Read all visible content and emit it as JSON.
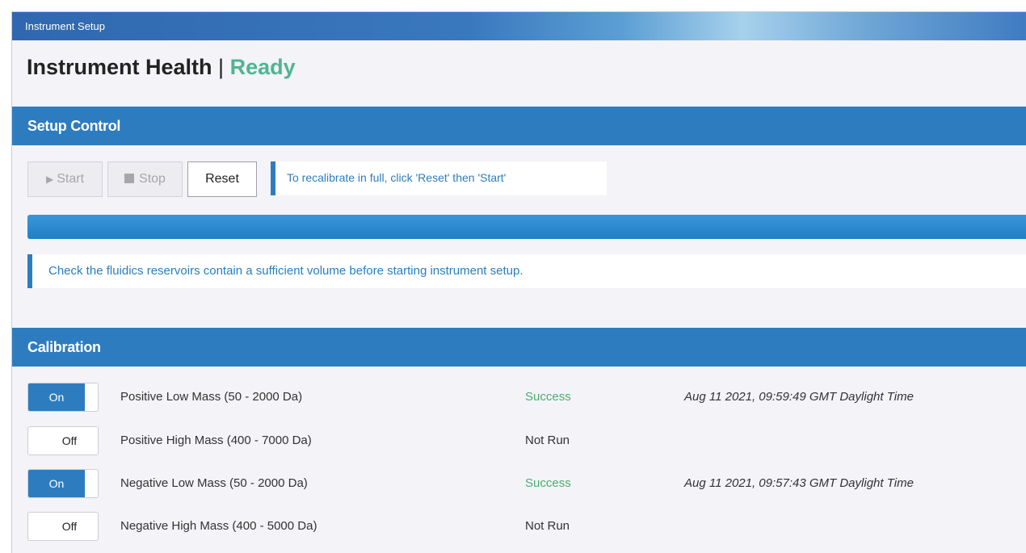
{
  "window": {
    "title": "Instrument Setup"
  },
  "health": {
    "title": "Instrument Health",
    "separator": "|",
    "status": "Ready"
  },
  "setup_control": {
    "header": "Setup Control",
    "buttons": {
      "start": "Start",
      "stop": "Stop",
      "reset": "Reset"
    },
    "hint": "To recalibrate in full, click 'Reset' then 'Start'",
    "progress": 1.0,
    "warning": "Check the fluidics reservoirs contain a sufficient volume before starting instrument setup."
  },
  "calibration": {
    "header": "Calibration",
    "rows": [
      {
        "toggle": "On",
        "name": "Positive Low Mass (50 - 2000 Da)",
        "status": "Success",
        "time": "Aug 11 2021, 09:59:49 GMT Daylight Time"
      },
      {
        "toggle": "Off",
        "name": "Positive High Mass (400 - 7000 Da)",
        "status": "Not Run",
        "time": ""
      },
      {
        "toggle": "On",
        "name": "Negative Low Mass (50 - 2000 Da)",
        "status": "Success",
        "time": "Aug 11 2021, 09:57:43 GMT Daylight Time"
      },
      {
        "toggle": "Off",
        "name": "Negative High Mass (400 - 5000 Da)",
        "status": "Not Run",
        "time": ""
      }
    ]
  },
  "colors": {
    "header_blue": "#2e7cc0",
    "ready_green": "#4fb58f",
    "success_green": "#4cae6c",
    "hint_text": "#2a7dbf"
  },
  "icons": {
    "start": "play-icon",
    "stop": "stop-square-icon"
  }
}
